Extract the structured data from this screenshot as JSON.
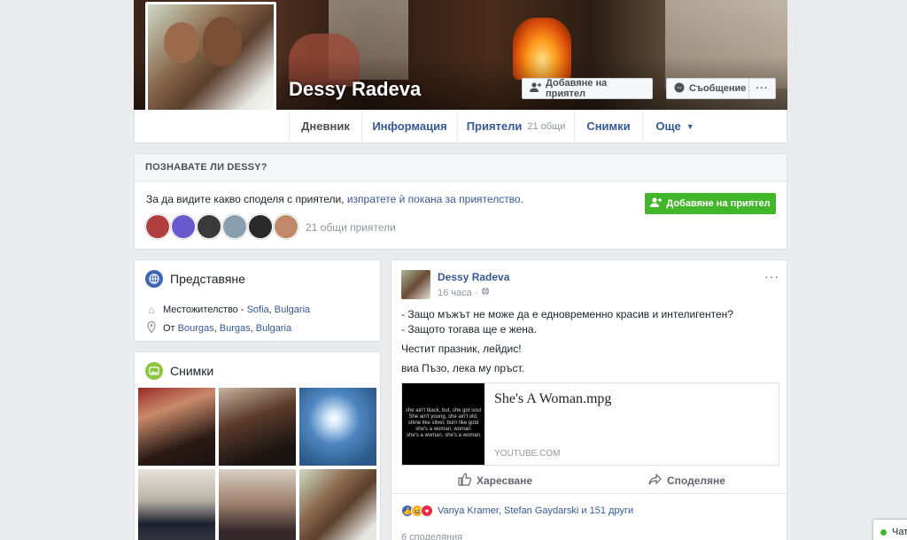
{
  "profile": {
    "name": "Dessy Radeva",
    "add_friend_label": "Добавяне на приятел",
    "message_label": "Съобщение",
    "more_label": "···"
  },
  "tabs": [
    {
      "label": "Дневник"
    },
    {
      "label": "Информация"
    },
    {
      "label": "Приятели",
      "count": "21 общи"
    },
    {
      "label": "Снимки"
    },
    {
      "label": "Още",
      "caret": "▼"
    }
  ],
  "know": {
    "heading": "ПОЗНАВАТЕ ЛИ DESSY?",
    "text_prefix": "За да видите какво споделя с приятели, ",
    "text_link": "изпратете ѝ покана за приятелство.",
    "add_label": "Добавяне на приятел",
    "mutual": "21 общи приятели",
    "avatar_colors": [
      "#b04040",
      "#6a5acd",
      "#3a3a3a",
      "#8aa0b0",
      "#2a2a2a",
      "#c08a6a"
    ]
  },
  "intro": {
    "title": "Представяне",
    "residence_prefix": "Местожителство - ",
    "residence_city": "Sofia",
    "residence_sep": ", ",
    "residence_country": "Bulgaria",
    "from_prefix": "От ",
    "from_city": "Bourgas",
    "from_sep1": ", ",
    "from_region": "Burgas",
    "from_sep2": ", ",
    "from_country": "Bulgaria"
  },
  "photos": {
    "title": "Снимки"
  },
  "post": {
    "author": "Dessy Radeva",
    "time": "16 часа · ",
    "line1": "- Защо мъжът не може да е едновременно красив и интелигентен?",
    "line2": "- Защото тогава ще е жена.",
    "line3": "Честит празник, лейдис!",
    "line4": "виа Пъзо, лека му пръст.",
    "link_title": "She's A Woman.mpg",
    "link_domain": "YOUTUBE.COM",
    "thumb_lines": [
      "she ain't black, but, she got soul",
      "She ain't young, she ain't old,",
      "shine like silver, burn like gold",
      "she's a woman, woman",
      "she's a woman, she's a woman"
    ],
    "like_label": "Харесване",
    "share_label": "Споделяне",
    "reactions_text": "Vanya Kramer, Stefan Gaydarski и 151 други",
    "shares_text": "6 споделяния"
  },
  "chat": {
    "label": "Чат"
  },
  "colors": {
    "link": "#365899",
    "green": "#42b72a",
    "background": "#e9ebee"
  }
}
